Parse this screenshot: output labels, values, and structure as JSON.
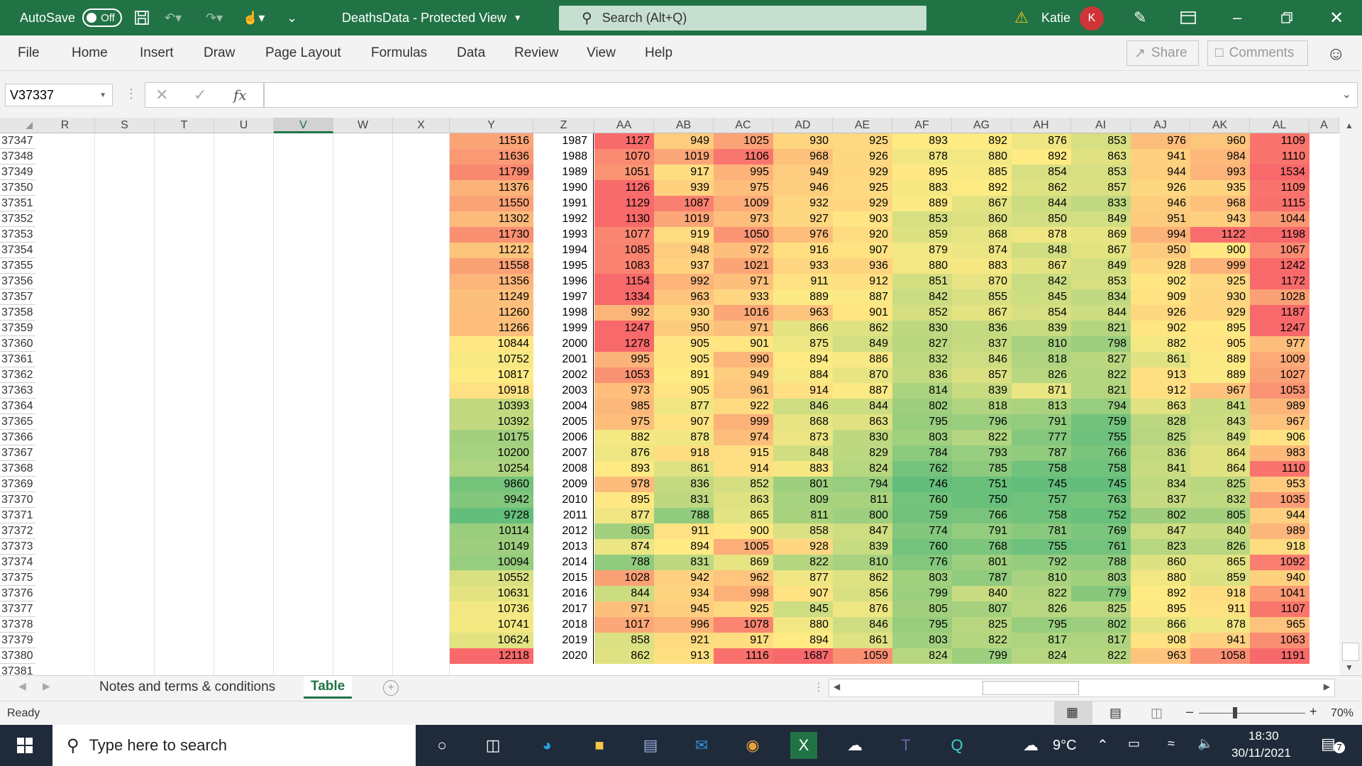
{
  "titlebar": {
    "autosave_label": "AutoSave",
    "autosave_state": "Off",
    "doc_title": "DeathsData  -  Protected View",
    "search_placeholder": "Search (Alt+Q)",
    "user_name": "Katie",
    "user_initial": "K"
  },
  "ribbon": {
    "tabs": [
      "File",
      "Home",
      "Insert",
      "Draw",
      "Page Layout",
      "Formulas",
      "Data",
      "Review",
      "View",
      "Help"
    ],
    "share_label": "Share",
    "comments_label": "Comments"
  },
  "formula_bar": {
    "name_box": "V37337",
    "fx_label": "fx",
    "content": ""
  },
  "grid": {
    "columns": [
      "R",
      "S",
      "T",
      "U",
      "V",
      "W",
      "X",
      "Y",
      "Z",
      "AA",
      "AB",
      "AC",
      "AD",
      "AE",
      "AF",
      "AG",
      "AH",
      "AI",
      "AJ",
      "AK",
      "AL",
      "A"
    ],
    "selected_column": "V",
    "row_numbers": [
      "37347",
      "37348",
      "37349",
      "37350",
      "37351",
      "37352",
      "37353",
      "37354",
      "37355",
      "37356",
      "37357",
      "37358",
      "37359",
      "37360",
      "37361",
      "37362",
      "37363",
      "37364",
      "37365",
      "37366",
      "37367",
      "37368",
      "37369",
      "37370",
      "37371",
      "37372",
      "37373",
      "37374",
      "37375",
      "37376",
      "37377",
      "37378",
      "37379",
      "37380",
      "37381"
    ],
    "years": [
      "1987",
      "1988",
      "1989",
      "1990",
      "1991",
      "1992",
      "1993",
      "1994",
      "1995",
      "1996",
      "1997",
      "1998",
      "1999",
      "2000",
      "2001",
      "2002",
      "2003",
      "2004",
      "2005",
      "2006",
      "2007",
      "2008",
      "2009",
      "2010",
      "2011",
      "2012",
      "2013",
      "2014",
      "2015",
      "2016",
      "2017",
      "2018",
      "2019",
      "2020"
    ],
    "y_values": [
      11516,
      11636,
      11799,
      11376,
      11550,
      11302,
      11730,
      11212,
      11558,
      11356,
      11249,
      11260,
      11266,
      10844,
      10752,
      10817,
      10918,
      10393,
      10392,
      10175,
      10200,
      10254,
      9860,
      9942,
      9728,
      10114,
      10149,
      10094,
      10552,
      10631,
      10736,
      10741,
      10624,
      12118
    ],
    "data_columns": [
      "AA",
      "AB",
      "AC",
      "AD",
      "AE",
      "AF",
      "AG",
      "AH",
      "AI",
      "AJ",
      "AK",
      "AL"
    ],
    "data_rows": [
      [
        1127,
        949,
        1025,
        930,
        925,
        893,
        892,
        876,
        853,
        976,
        960,
        1109
      ],
      [
        1070,
        1019,
        1106,
        968,
        926,
        878,
        880,
        892,
        863,
        941,
        984,
        1110
      ],
      [
        1051,
        917,
        995,
        949,
        929,
        895,
        885,
        854,
        853,
        944,
        993,
        1534
      ],
      [
        1126,
        939,
        975,
        946,
        925,
        883,
        892,
        862,
        857,
        926,
        935,
        1109
      ],
      [
        1129,
        1087,
        1009,
        932,
        929,
        889,
        867,
        844,
        833,
        946,
        968,
        1115
      ],
      [
        1130,
        1019,
        973,
        927,
        903,
        853,
        860,
        850,
        849,
        951,
        943,
        1044
      ],
      [
        1077,
        919,
        1050,
        976,
        920,
        859,
        868,
        878,
        869,
        994,
        1122,
        1198
      ],
      [
        1085,
        948,
        972,
        916,
        907,
        879,
        874,
        848,
        867,
        950,
        900,
        1067
      ],
      [
        1083,
        937,
        1021,
        933,
        936,
        880,
        883,
        867,
        849,
        928,
        999,
        1242
      ],
      [
        1154,
        992,
        971,
        911,
        912,
        851,
        870,
        842,
        853,
        902,
        925,
        1172
      ],
      [
        1334,
        963,
        933,
        889,
        887,
        842,
        855,
        845,
        834,
        909,
        930,
        1028
      ],
      [
        992,
        930,
        1016,
        963,
        901,
        852,
        867,
        854,
        844,
        926,
        929,
        1187
      ],
      [
        1247,
        950,
        971,
        866,
        862,
        830,
        836,
        839,
        821,
        902,
        895,
        1247
      ],
      [
        1278,
        905,
        901,
        875,
        849,
        827,
        837,
        810,
        798,
        882,
        905,
        977
      ],
      [
        995,
        905,
        990,
        894,
        886,
        832,
        846,
        818,
        827,
        861,
        889,
        1009
      ],
      [
        1053,
        891,
        949,
        884,
        870,
        836,
        857,
        826,
        822,
        913,
        889,
        1027
      ],
      [
        973,
        905,
        961,
        914,
        887,
        814,
        839,
        871,
        821,
        912,
        967,
        1053
      ],
      [
        985,
        877,
        922,
        846,
        844,
        802,
        818,
        813,
        794,
        863,
        841,
        989
      ],
      [
        975,
        907,
        999,
        868,
        863,
        795,
        796,
        791,
        759,
        828,
        843,
        967
      ],
      [
        882,
        878,
        974,
        873,
        830,
        803,
        822,
        777,
        755,
        825,
        849,
        906
      ],
      [
        876,
        918,
        915,
        848,
        829,
        784,
        793,
        787,
        766,
        836,
        864,
        983
      ],
      [
        893,
        861,
        914,
        883,
        824,
        762,
        785,
        758,
        758,
        841,
        864,
        1110
      ],
      [
        978,
        836,
        852,
        801,
        794,
        746,
        751,
        745,
        745,
        834,
        825,
        953
      ],
      [
        895,
        831,
        863,
        809,
        811,
        760,
        750,
        757,
        763,
        837,
        832,
        1035
      ],
      [
        877,
        788,
        865,
        811,
        800,
        759,
        766,
        758,
        752,
        802,
        805,
        944
      ],
      [
        805,
        911,
        900,
        858,
        847,
        774,
        791,
        781,
        769,
        847,
        840,
        989
      ],
      [
        874,
        894,
        1005,
        928,
        839,
        760,
        768,
        755,
        761,
        823,
        826,
        918
      ],
      [
        788,
        831,
        869,
        822,
        810,
        776,
        801,
        792,
        788,
        860,
        865,
        1092
      ],
      [
        1028,
        942,
        962,
        877,
        862,
        803,
        787,
        810,
        803,
        880,
        859,
        940
      ],
      [
        844,
        934,
        998,
        907,
        856,
        799,
        840,
        822,
        779,
        892,
        918,
        1041
      ],
      [
        971,
        945,
        925,
        845,
        876,
        805,
        807,
        826,
        825,
        895,
        911,
        1107
      ],
      [
        1017,
        996,
        1078,
        880,
        846,
        795,
        825,
        795,
        802,
        866,
        878,
        965
      ],
      [
        858,
        921,
        917,
        894,
        861,
        803,
        822,
        817,
        817,
        908,
        941,
        1063
      ],
      [
        862,
        913,
        1116,
        1687,
        1059,
        824,
        799,
        824,
        822,
        963,
        1058,
        1191
      ]
    ]
  },
  "sheets": {
    "tabs": [
      "Notes and terms & conditions",
      "Table"
    ],
    "active": "Table"
  },
  "status": {
    "ready": "Ready",
    "zoom": "70%"
  },
  "taskbar": {
    "search_placeholder": "Type here to search",
    "weather": "9°C",
    "time": "18:30",
    "date": "30/11/2021",
    "notif_count": "7"
  },
  "colors": {
    "excel_green": "#217346",
    "heat_low": "#63be7b",
    "heat_mid": "#ffeb84",
    "heat_high": "#f8696b"
  }
}
